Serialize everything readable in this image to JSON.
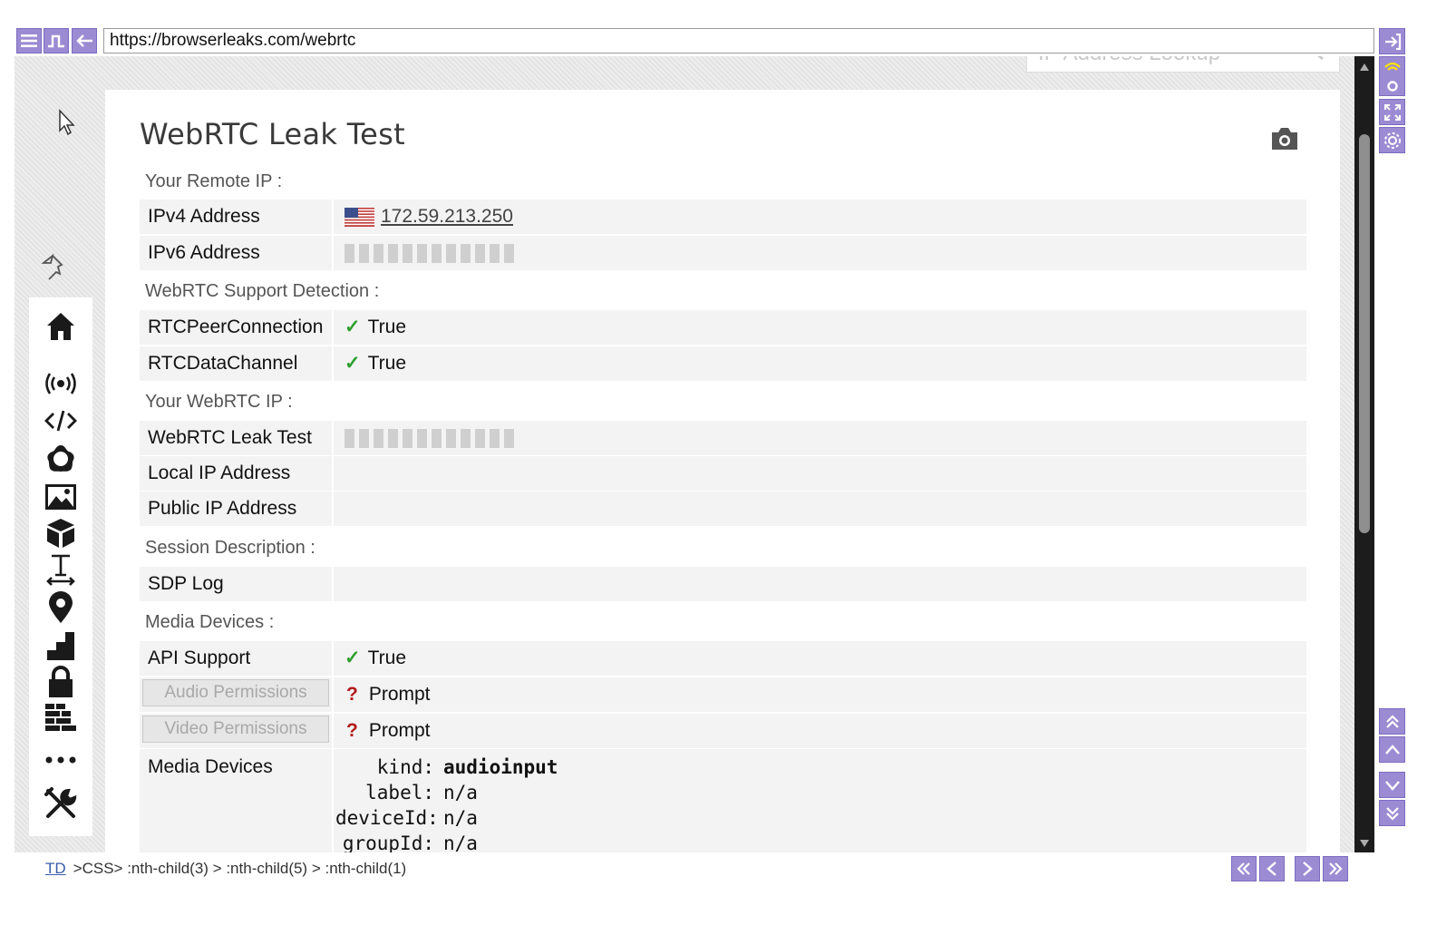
{
  "toolbar": {
    "url": "https://browserleaks.com/webrtc",
    "buttons": [
      "menu-icon",
      "step-icon",
      "back-arrow-icon"
    ]
  },
  "header": {
    "lookup_placeholder": "IP Address Lookup"
  },
  "sidebar": {
    "icons": [
      "home-icon",
      "broadcast-icon",
      "code-icon",
      "flower-icon",
      "image-icon",
      "cube-icon",
      "text-cursor-icon",
      "location-pin-icon",
      "chart-icon",
      "lock-icon",
      "firewall-icon",
      "more-icon",
      "tools-icon"
    ]
  },
  "page": {
    "title": "WebRTC Leak Test",
    "sections": {
      "remote_ip": "Your Remote IP :",
      "support": "WebRTC Support Detection :",
      "webrtc_ip": "Your WebRTC IP :",
      "session": "Session Description :",
      "media": "Media Devices :"
    },
    "rows": {
      "ipv4_label": "IPv4 Address",
      "ipv4_value": "172.59.213.250",
      "ipv6_label": "IPv6 Address",
      "rtcpeer_label": "RTCPeerConnection",
      "rtcpeer_value": "True",
      "rtcdata_label": "RTCDataChannel",
      "rtcdata_value": "True",
      "leak_label": "WebRTC Leak Test",
      "local_label": "Local IP Address",
      "public_label": "Public IP Address",
      "sdp_label": "SDP Log",
      "api_label": "API Support",
      "api_value": "True",
      "audio_button": "Audio Permissions",
      "audio_value": "Prompt",
      "video_button": "Video Permissions",
      "video_value": "Prompt",
      "devices_label": "Media Devices"
    },
    "checkmark": "✓",
    "question": "?",
    "media_device": {
      "kind_key": "kind:",
      "kind": "audioinput",
      "label_key": "label:",
      "label": "n/a",
      "deviceId_key": "deviceId:",
      "deviceId": "n/a",
      "groupId_key": "groupId:",
      "groupId": "n/a"
    }
  },
  "statusbar": {
    "td": "TD",
    "path": ">CSS> :nth-child(3) > :nth-child(5) > :nth-child(1)"
  },
  "colors": {
    "accent": "#9b8bd3",
    "check": "#2d9f2d",
    "question": "#b11a1a"
  }
}
